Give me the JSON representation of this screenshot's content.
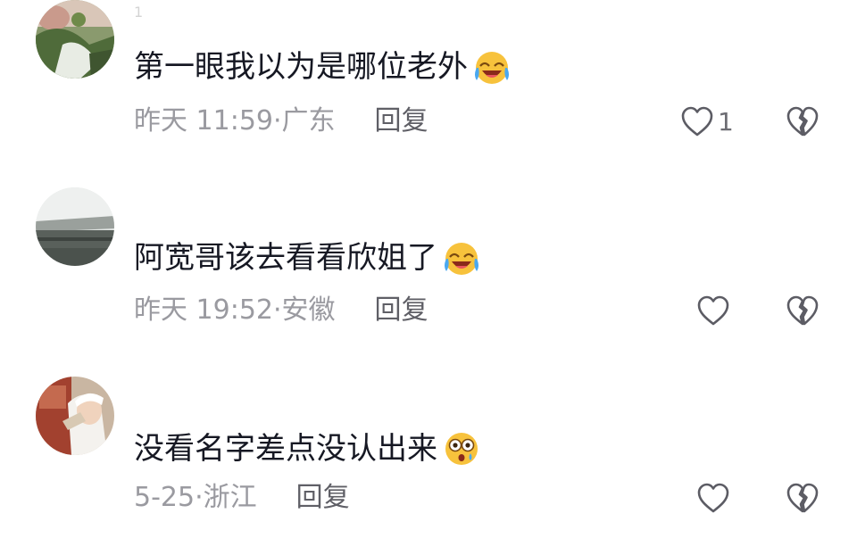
{
  "comments": [
    {
      "username": "1",
      "text": "第一眼我以为是哪位老外",
      "emoji": "cry-laugh-emoji",
      "time": "昨天 11:59",
      "location": "广东",
      "reply_label": "回复",
      "like_count": "1"
    },
    {
      "username": "",
      "text": "阿宽哥该去看看欣姐了",
      "emoji": "cry-laugh-emoji",
      "time": "昨天 19:52",
      "location": "安徽",
      "reply_label": "回复",
      "like_count": ""
    },
    {
      "username": "",
      "text": "没看名字差点没认出来",
      "emoji": "shocked-emoji",
      "time": "5-25",
      "location": "浙江",
      "reply_label": "回复",
      "like_count": ""
    }
  ],
  "colors": {
    "text": "#161823",
    "meta": "#9a9aa0",
    "reply": "#5f5f66",
    "icon": "#5c5c64"
  }
}
